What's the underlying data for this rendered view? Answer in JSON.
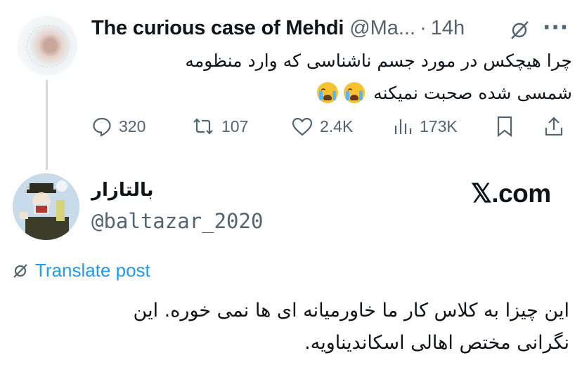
{
  "tweet": {
    "author_name": "The curious case of Mehdi",
    "handle": "@Ma...",
    "separator": "·",
    "time": "14h",
    "text_line1": "چرا هیچکس در مورد جسم ناشناسی که وارد منظومه",
    "text_line2": "شمسی شده صحبت نمیکنه",
    "emoji_icons": [
      "loudly-crying-face-icon",
      "loudly-crying-face-icon"
    ],
    "stats": {
      "replies": "320",
      "reposts": "107",
      "likes": "2.4K",
      "views": "173K"
    }
  },
  "quote": {
    "author_name": "بالتازار",
    "handle": "@baltazar_2020",
    "brand": "𝕏.com",
    "translate_label": "Translate post",
    "text_line1": "این چیزا به کلاس کار ما خاورمیانه ای ها نمی خوره. این",
    "text_line2": "نگرانی مختص اهالی اسکاندیناویه."
  },
  "colors": {
    "text": "#0f1419",
    "secondary": "#536471",
    "link": "#1d9bf0",
    "thread_line": "#cfd9de"
  }
}
